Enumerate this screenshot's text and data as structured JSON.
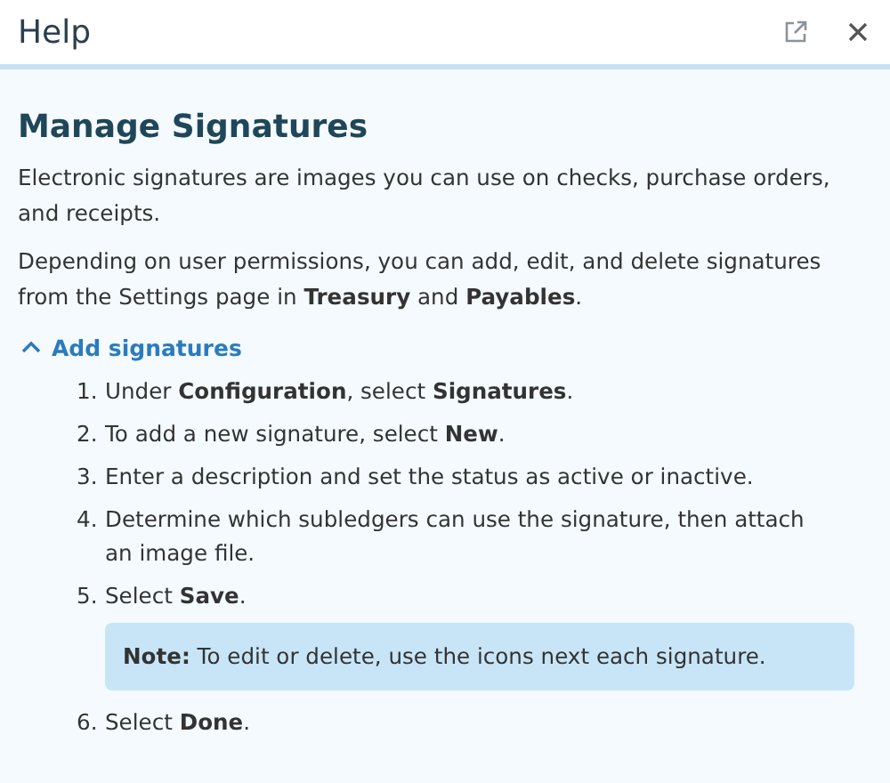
{
  "window": {
    "title": "Help"
  },
  "article": {
    "title": "Manage Signatures",
    "paragraphs": [
      "Electronic signatures are images you can use on checks, purchase orders, and receipts.",
      "Depending on user permissions, you can add, edit, and delete signatures from the Settings page in **Treasury** and **Payables**."
    ],
    "section": {
      "label": "Add signatures",
      "expanded": true,
      "steps": [
        {
          "kind": "step",
          "number": "1.",
          "text": "Under **Configuration**, select **Signatures**."
        },
        {
          "kind": "step",
          "number": "2.",
          "text": "To add a new signature, select **New**."
        },
        {
          "kind": "step",
          "number": "3.",
          "text": "Enter a description and set the status as active or inactive."
        },
        {
          "kind": "step",
          "number": "4.",
          "text": "Determine which subledgers can use the signature, then attach an image file."
        },
        {
          "kind": "step",
          "number": "5.",
          "text": "Select **Save**."
        },
        {
          "kind": "note",
          "text": "**Note:** To edit or delete, use the icons next each signature."
        },
        {
          "kind": "step",
          "number": "6.",
          "text": "Select **Done**."
        }
      ]
    }
  }
}
